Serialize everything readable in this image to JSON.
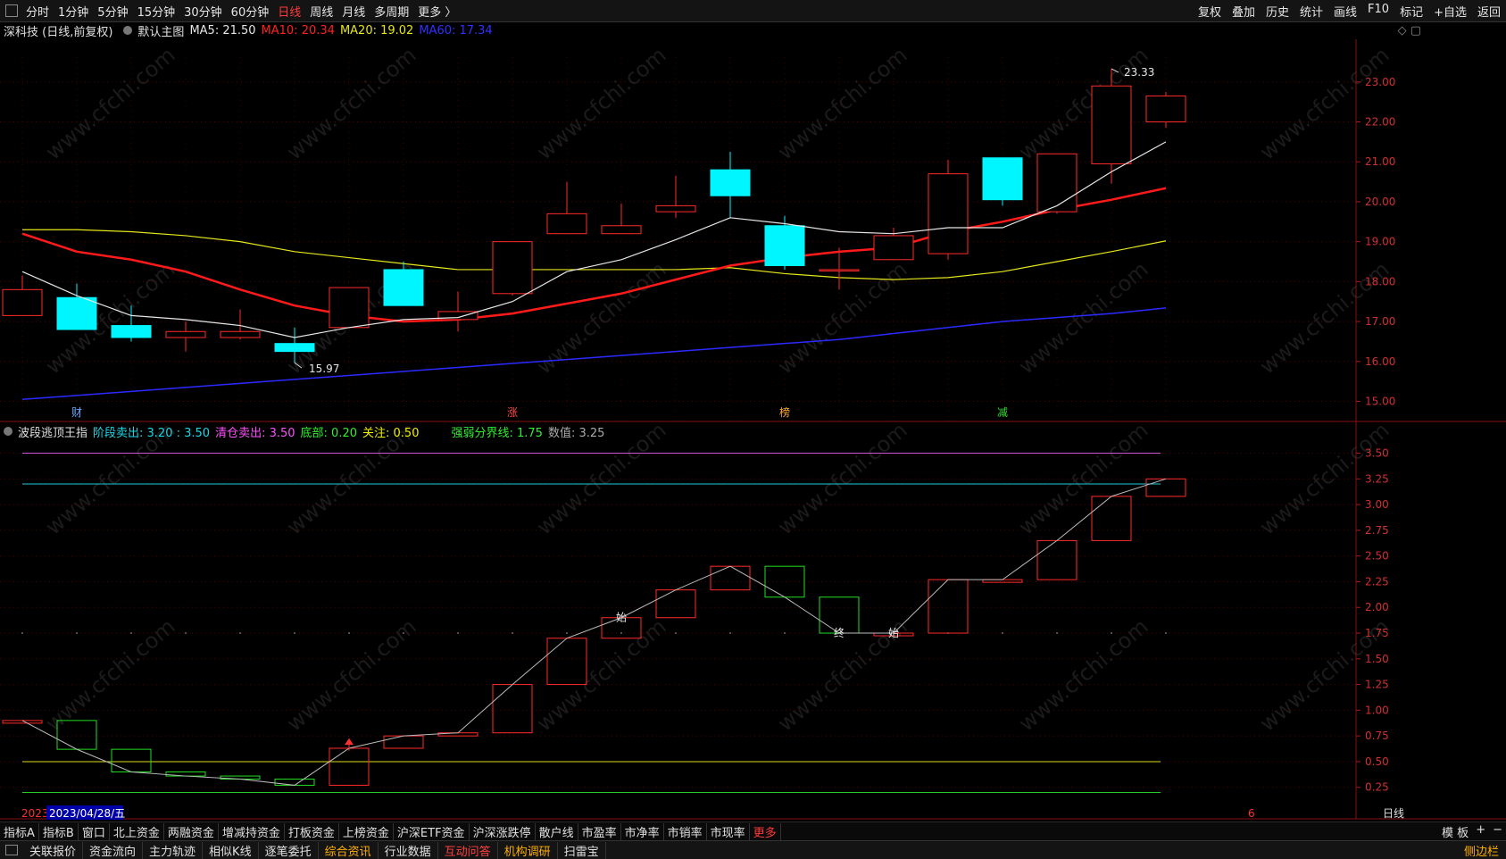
{
  "topbar": {
    "periods": [
      "分时",
      "1分钟",
      "5分钟",
      "15分钟",
      "30分钟",
      "60分钟",
      "日线",
      "周线",
      "月线",
      "多周期",
      "更多 〉"
    ],
    "active_period": "日线",
    "right_buttons": [
      "复权",
      "叠加",
      "历史",
      "统计",
      "画线",
      "F10",
      "标记",
      "+自选",
      "返回"
    ]
  },
  "info": {
    "stock": "深科技 (日线,前复权)",
    "main_chart": "默认主图",
    "ma5": "MA5: 21.50",
    "ma10": "MA10: 20.34",
    "ma20": "MA20: 19.02",
    "ma60": "MA60: 17.34",
    "corner_icons": "◇ ▢"
  },
  "indicator": {
    "name": "波段逃顶王指",
    "stage_sell": "阶段卖出: 3.20 : 3.50",
    "clear_sell": "清仓卖出: 3.50",
    "bottom": "底部: 0.20",
    "focus": "关注: 0.50",
    "threshold": "强弱分界线: 1.75",
    "value": "数值: 3.25"
  },
  "colors": {
    "up": "#ff2a2a",
    "down": "#00f6ff",
    "ma5": "#e6e6e6",
    "ma10": "#ff1a1a",
    "ma20": "#e6e61a",
    "ma60": "#2a2aff",
    "ind_up": "#ff2a2a",
    "ind_down": "#22dd22"
  },
  "price_labels": {
    "high": "23.33",
    "low": "15.97"
  },
  "event_markers": [
    "财",
    "涨",
    "榜",
    "减"
  ],
  "ind_markers": [
    "始",
    "终",
    "始"
  ],
  "date_start": "2023",
  "cursor_date": "2023/04/28/五",
  "axis_end_label": "6",
  "period_label": "日线",
  "chart_data": [
    {
      "type": "candlestick",
      "y_ticks": [
        23.0,
        22.0,
        21.0,
        20.0,
        19.0,
        18.0,
        17.0,
        16.0,
        15.0
      ],
      "ylim": [
        14.9,
        23.8
      ],
      "candles": [
        {
          "o": 17.15,
          "h": 18.15,
          "l": 17.15,
          "c": 17.8
        },
        {
          "o": 17.6,
          "h": 17.95,
          "l": 16.8,
          "c": 16.8
        },
        {
          "o": 16.9,
          "h": 17.4,
          "l": 16.5,
          "c": 16.6
        },
        {
          "o": 16.6,
          "h": 17.0,
          "l": 16.25,
          "c": 16.75
        },
        {
          "o": 16.6,
          "h": 17.3,
          "l": 16.55,
          "c": 16.75
        },
        {
          "o": 16.45,
          "h": 16.85,
          "l": 15.97,
          "c": 16.25
        },
        {
          "o": 16.85,
          "h": 17.85,
          "l": 16.85,
          "c": 17.85
        },
        {
          "o": 18.3,
          "h": 18.5,
          "l": 17.4,
          "c": 17.4
        },
        {
          "o": 17.05,
          "h": 17.75,
          "l": 16.75,
          "c": 17.25
        },
        {
          "o": 17.7,
          "h": 19.0,
          "l": 17.65,
          "c": 19.0
        },
        {
          "o": 19.2,
          "h": 20.5,
          "l": 19.2,
          "c": 19.7
        },
        {
          "o": 19.2,
          "h": 19.95,
          "l": 19.2,
          "c": 19.4
        },
        {
          "o": 19.75,
          "h": 20.65,
          "l": 19.6,
          "c": 19.9
        },
        {
          "o": 20.8,
          "h": 21.25,
          "l": 19.6,
          "c": 20.15
        },
        {
          "o": 19.4,
          "h": 19.65,
          "l": 18.3,
          "c": 18.4
        },
        {
          "o": 18.3,
          "h": 18.85,
          "l": 17.8,
          "c": 18.3
        },
        {
          "o": 18.55,
          "h": 19.35,
          "l": 18.55,
          "c": 19.15
        },
        {
          "o": 18.7,
          "h": 21.05,
          "l": 18.55,
          "c": 20.7
        },
        {
          "o": 21.1,
          "h": 21.1,
          "l": 19.9,
          "c": 20.05
        },
        {
          "o": 19.75,
          "h": 21.2,
          "l": 19.7,
          "c": 21.2
        },
        {
          "o": 20.95,
          "h": 23.33,
          "l": 20.45,
          "c": 22.9
        },
        {
          "o": 22.0,
          "h": 22.75,
          "l": 21.85,
          "c": 22.65
        }
      ],
      "ma5": [
        18.25,
        17.65,
        17.15,
        17.05,
        16.9,
        16.6,
        16.85,
        17.05,
        17.1,
        17.5,
        18.25,
        18.55,
        19.05,
        19.6,
        19.45,
        19.25,
        19.2,
        19.35,
        19.35,
        19.9,
        20.75,
        21.5
      ],
      "ma10": [
        19.2,
        18.75,
        18.55,
        18.25,
        17.8,
        17.4,
        17.15,
        17.0,
        17.05,
        17.2,
        17.45,
        17.7,
        18.05,
        18.4,
        18.6,
        18.75,
        18.85,
        19.25,
        19.5,
        19.8,
        20.05,
        20.34
      ],
      "ma20": [
        19.3,
        19.3,
        19.25,
        19.15,
        19.0,
        18.75,
        18.6,
        18.45,
        18.3,
        18.3,
        18.3,
        18.3,
        18.3,
        18.35,
        18.2,
        18.1,
        18.05,
        18.1,
        18.25,
        18.5,
        18.75,
        19.02
      ],
      "ma60": [
        15.05,
        15.15,
        15.25,
        15.35,
        15.45,
        15.55,
        15.65,
        15.75,
        15.85,
        15.95,
        16.05,
        16.15,
        16.25,
        16.35,
        16.45,
        16.55,
        16.7,
        16.85,
        17.0,
        17.1,
        17.2,
        17.34
      ]
    },
    {
      "type": "indicator-boxes",
      "y_ticks": [
        3.5,
        3.25,
        3.0,
        2.75,
        2.5,
        2.25,
        2.0,
        1.75,
        1.5,
        1.25,
        1.0,
        0.75,
        0.5,
        0.25
      ],
      "ylim": [
        0.1,
        3.6
      ],
      "levels": {
        "clear_sell": 3.5,
        "stage_sell": 3.2,
        "focus": 0.5,
        "bottom": 0.2,
        "threshold": 1.75
      },
      "values": [
        0.9,
        0.62,
        0.4,
        0.36,
        0.33,
        0.27,
        0.63,
        0.75,
        0.78,
        1.25,
        1.7,
        1.9,
        2.17,
        2.4,
        2.1,
        1.75,
        1.75,
        2.27,
        2.27,
        2.65,
        3.08,
        3.25
      ],
      "prev": [
        0.9,
        0.9,
        0.62,
        0.4,
        0.36,
        0.33,
        0.27,
        0.63,
        0.75,
        0.78,
        1.25,
        1.7,
        1.9,
        2.17,
        2.4,
        2.1,
        1.75,
        1.75,
        2.27,
        2.27,
        2.65,
        3.08
      ]
    }
  ]
}
